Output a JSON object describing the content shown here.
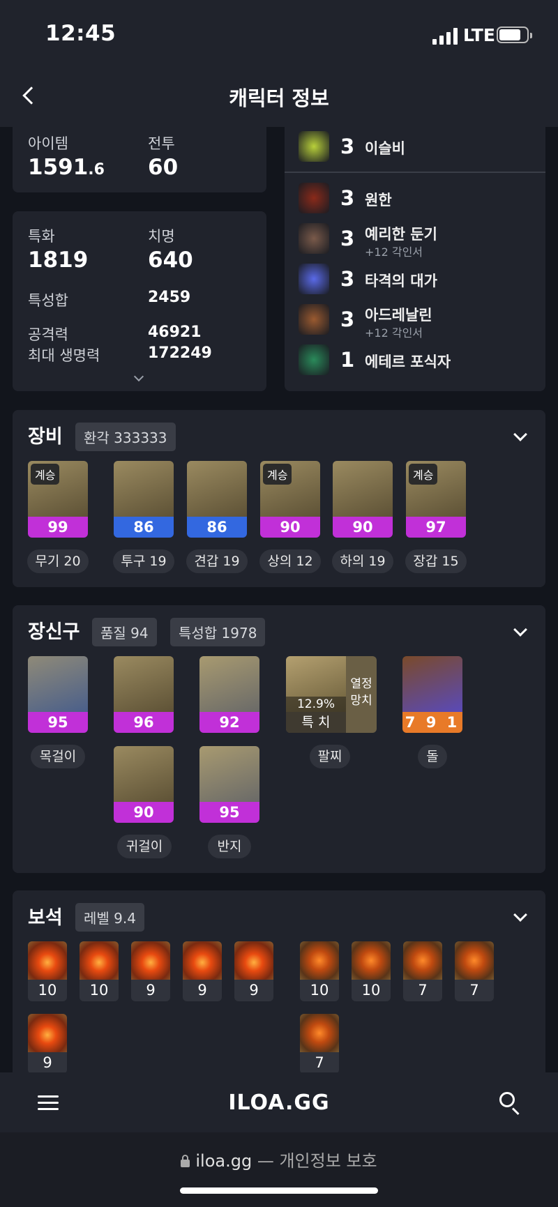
{
  "status": {
    "time": "12:45",
    "network": "LTE"
  },
  "header": {
    "title": "캐릭터 정보"
  },
  "stats_top": {
    "item_label": "아이템",
    "item_value": "1591",
    "item_decimal": ".6",
    "combat_label": "전투",
    "combat_value": "60"
  },
  "stats_main": {
    "spec_label": "특화",
    "spec_value": "1819",
    "crit_label": "치명",
    "crit_value": "640",
    "trait_sum_label": "특성합",
    "trait_sum_value": "2459",
    "attack_label": "공격력",
    "attack_value": "46921",
    "hp_label": "최대 생명력",
    "hp_value": "172249"
  },
  "engravings": [
    {
      "level": "3",
      "name": "이슬비",
      "sub": "",
      "icon": "rain-icon",
      "color": "#b8d03a"
    },
    {
      "level": "3",
      "name": "원한",
      "sub": "",
      "icon": "grudge-icon",
      "color": "#8a2a1a"
    },
    {
      "level": "3",
      "name": "예리한 둔기",
      "sub": "+12 각인서",
      "icon": "blunt-icon",
      "color": "#7a5a4a"
    },
    {
      "level": "3",
      "name": "타격의 대가",
      "sub": "",
      "icon": "strike-icon",
      "color": "#5a6ae8"
    },
    {
      "level": "3",
      "name": "아드레날린",
      "sub": "+12 각인서",
      "icon": "adrenaline-icon",
      "color": "#9a5a30"
    },
    {
      "level": "1",
      "name": "에테르 포식자",
      "sub": "",
      "icon": "ether-icon",
      "color": "#2a8a5a"
    }
  ],
  "equipment": {
    "title": "장비",
    "tag": "환각 333333",
    "items": [
      {
        "quality": "99",
        "tier": "purple",
        "badge": "계승",
        "label": "무기 20",
        "icon": "weapon-icon"
      },
      {
        "quality": "86",
        "tier": "blue",
        "badge": "",
        "label": "투구 19",
        "icon": "helmet-icon"
      },
      {
        "quality": "86",
        "tier": "blue",
        "badge": "",
        "label": "견갑 19",
        "icon": "shoulder-icon"
      },
      {
        "quality": "90",
        "tier": "purple",
        "badge": "계승",
        "label": "상의 12",
        "icon": "chest-icon"
      },
      {
        "quality": "90",
        "tier": "purple",
        "badge": "",
        "label": "하의 19",
        "icon": "pants-icon"
      },
      {
        "quality": "97",
        "tier": "purple",
        "badge": "계승",
        "label": "장갑 15",
        "icon": "gloves-icon"
      }
    ]
  },
  "accessories": {
    "title": "장신구",
    "tag1": "품질 94",
    "tag2": "특성합 1978",
    "necklace": {
      "quality": "95",
      "label": "목걸이"
    },
    "earring1": {
      "quality": "96"
    },
    "earring2": {
      "quality": "90"
    },
    "earring_label": "귀걸이",
    "ring1": {
      "quality": "92"
    },
    "ring2": {
      "quality": "95"
    },
    "ring_label": "반지",
    "bracelet": {
      "percent": "12.9%",
      "stats": "특 치",
      "side": "열정\n망치",
      "label": "팔찌"
    },
    "stone": {
      "value": "7 9 1",
      "label": "돌"
    }
  },
  "gems": {
    "title": "보석",
    "tag": "레벨 9.4",
    "left_row1": [
      "10",
      "10",
      "9",
      "9",
      "9"
    ],
    "left_row2": [
      "9"
    ],
    "right_row1": [
      "10",
      "10",
      "7",
      "7"
    ],
    "right_row2": [
      "7"
    ]
  },
  "nav": {
    "logo": "ILOA.GG"
  },
  "browser": {
    "domain": "iloa.gg",
    "suffix": " — 개인정보 보호"
  }
}
